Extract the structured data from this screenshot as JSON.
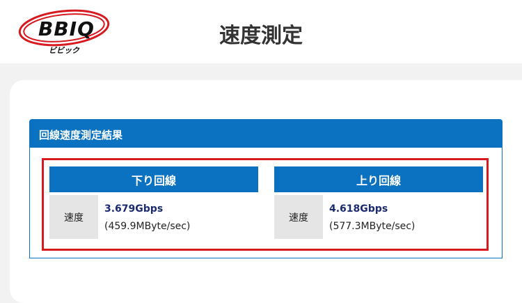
{
  "header": {
    "logo_text": "BBIQ",
    "logo_sub": "ビビック",
    "title": "速度測定"
  },
  "result": {
    "section_title": "回線速度測定結果",
    "download": {
      "heading": "下り回線",
      "label": "速度",
      "speed": "3.679Gbps",
      "bytes": "(459.9MByte/sec)"
    },
    "upload": {
      "heading": "上り回線",
      "label": "速度",
      "speed": "4.618Gbps",
      "bytes": "(577.3MByte/sec)"
    }
  },
  "colors": {
    "accent": "#0a72c0",
    "highlight": "#d71920",
    "logo": "#d71920"
  }
}
